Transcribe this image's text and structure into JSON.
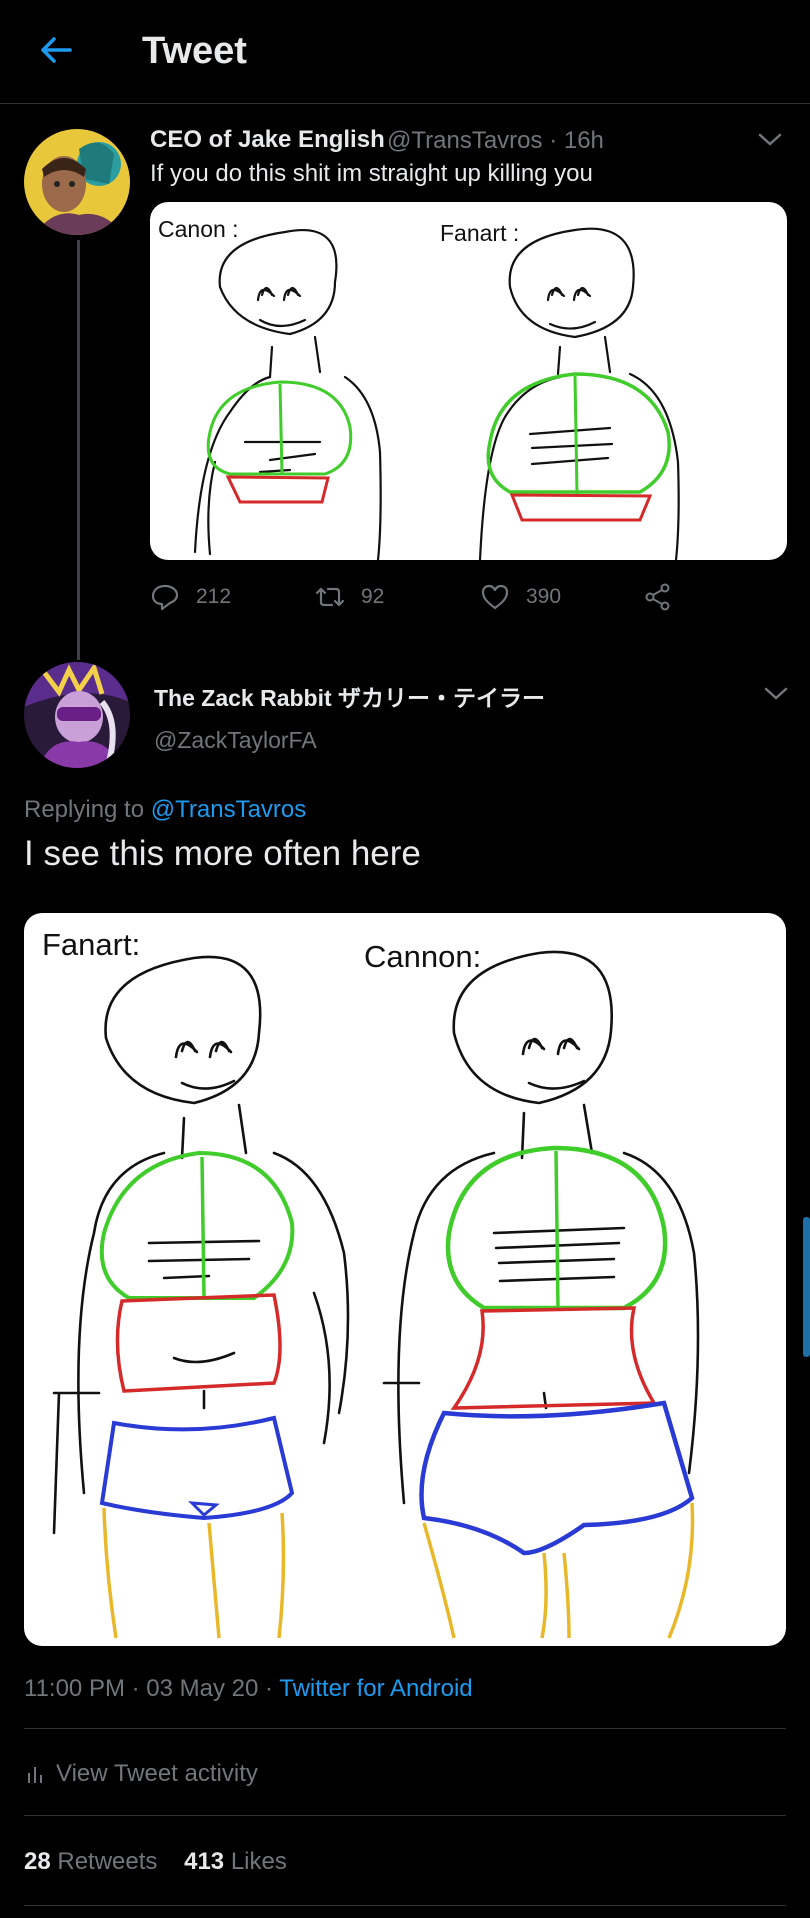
{
  "header": {
    "title": "Tweet"
  },
  "tweet1": {
    "name": "CEO of Jake English",
    "handle": "@TransTavros",
    "time": "· 16h",
    "text": "If you do this shit im straight up killing you",
    "image_labels": {
      "left": "Canon :",
      "right": "Fanart :"
    },
    "actions": {
      "replies": "212",
      "retweets": "92",
      "likes": "390"
    }
  },
  "tweet2": {
    "name": "The Zack Rabbit ザカリー・テイラー",
    "handle": "@ZackTaylorFA",
    "replying_prefix": "Replying to",
    "replying_handle": "@TransTavros",
    "text": "I see this more often here",
    "image_labels": {
      "left": "Fanart:",
      "right": "Cannon:"
    },
    "timestamp": "11:00 PM · 03 May 20 ·",
    "source": "Twitter for Android",
    "activity_label": "View Tweet activity",
    "retweets_count": "28",
    "retweets_label": "Retweets",
    "likes_count": "413",
    "likes_label": "Likes"
  },
  "colors": {
    "accent": "#1d9bf0",
    "muted": "#71767b",
    "text": "#e7e9ea"
  }
}
